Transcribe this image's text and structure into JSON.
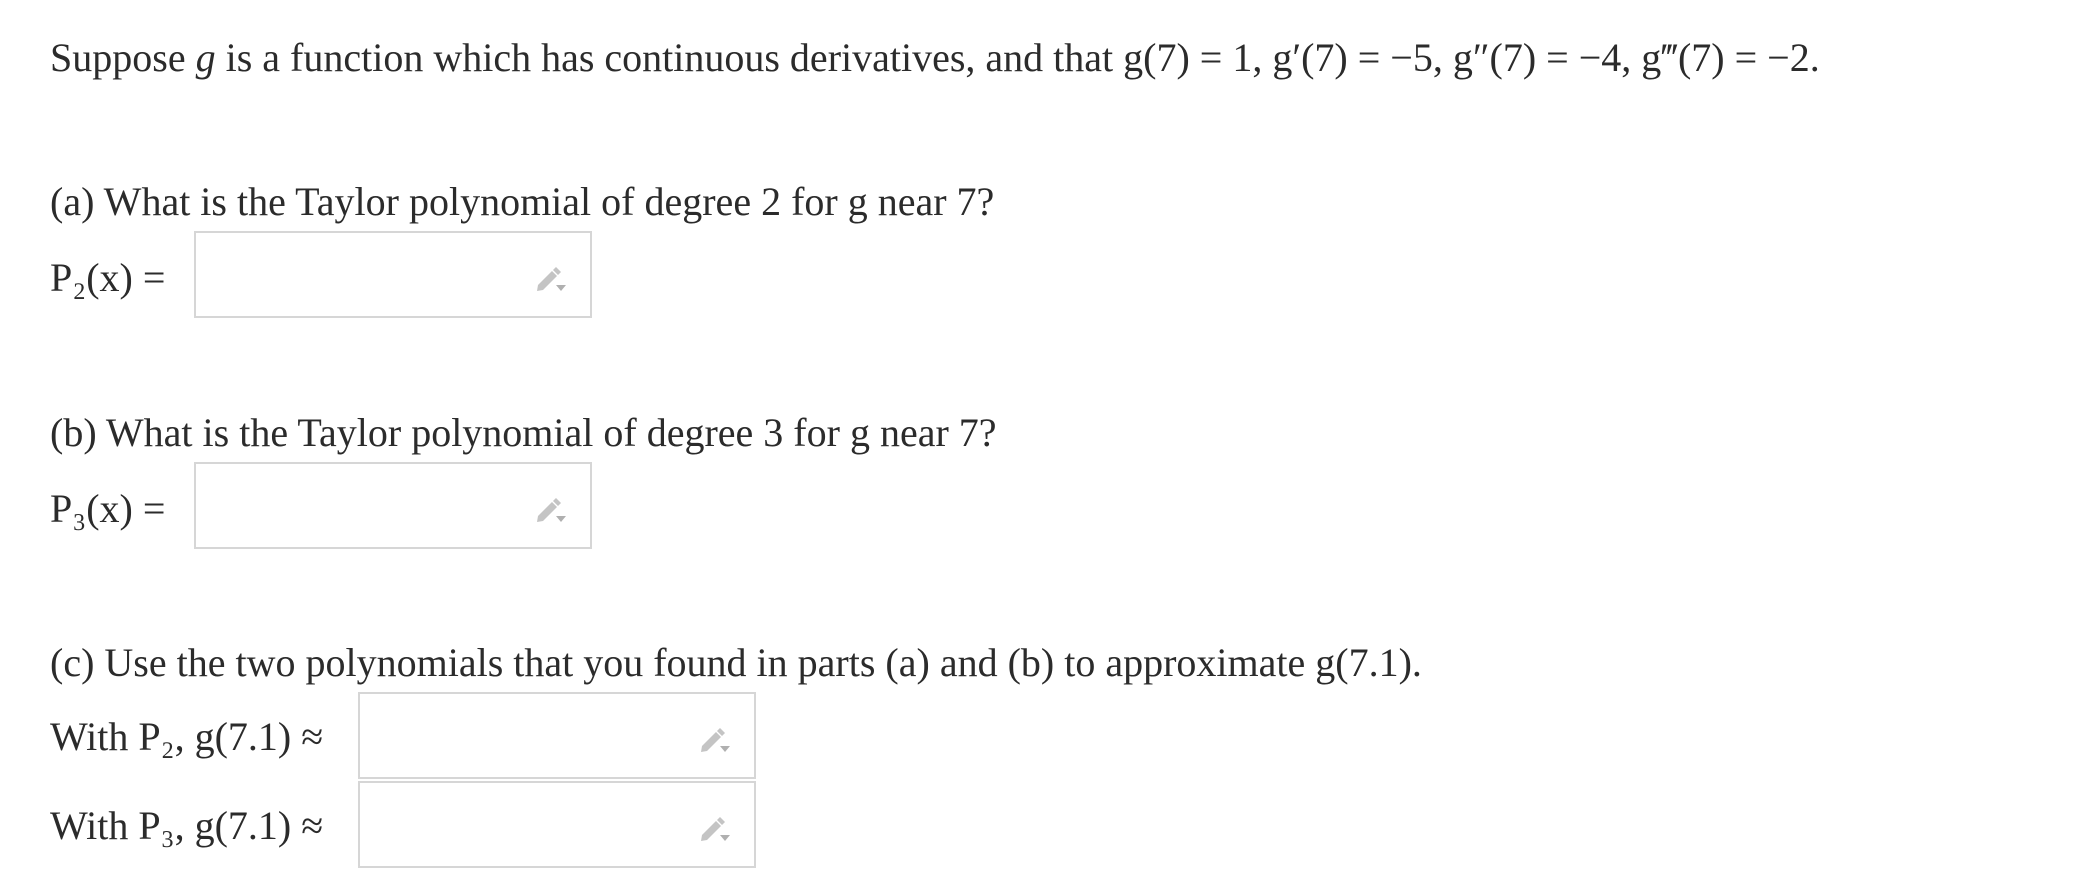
{
  "intro": {
    "text_start": "Suppose ",
    "g": "g",
    "text_mid": " is a function which has continuous derivatives, and that ",
    "values": "g(7) = 1, g′(7) = −5, g″(7) = −4, g‴(7) = −2."
  },
  "part_a": {
    "marker": "(a)",
    "question": " What is the Taylor polynomial of degree 2 for g near 7?",
    "label": "P₂(x) =",
    "answer_value": ""
  },
  "part_b": {
    "marker": "(b)",
    "question": " What is the Taylor polynomial of degree 3 for g near 7?",
    "label": "P₃(x) =",
    "answer_value": ""
  },
  "part_c": {
    "marker": "(c)",
    "question": " Use the two polynomials that you found in parts (a) and (b) to approximate g(7.1).",
    "label_p2": "With P₂, g(7.1) ≈",
    "label_p3": "With P₃, g(7.1) ≈",
    "answer_p2": "",
    "answer_p3": ""
  },
  "icons": {
    "edit": "pencil-dropdown-icon"
  },
  "colors": {
    "text": "#2b2b2b",
    "box_border": "#d6d6d6",
    "icon": "#bdbdbd"
  }
}
